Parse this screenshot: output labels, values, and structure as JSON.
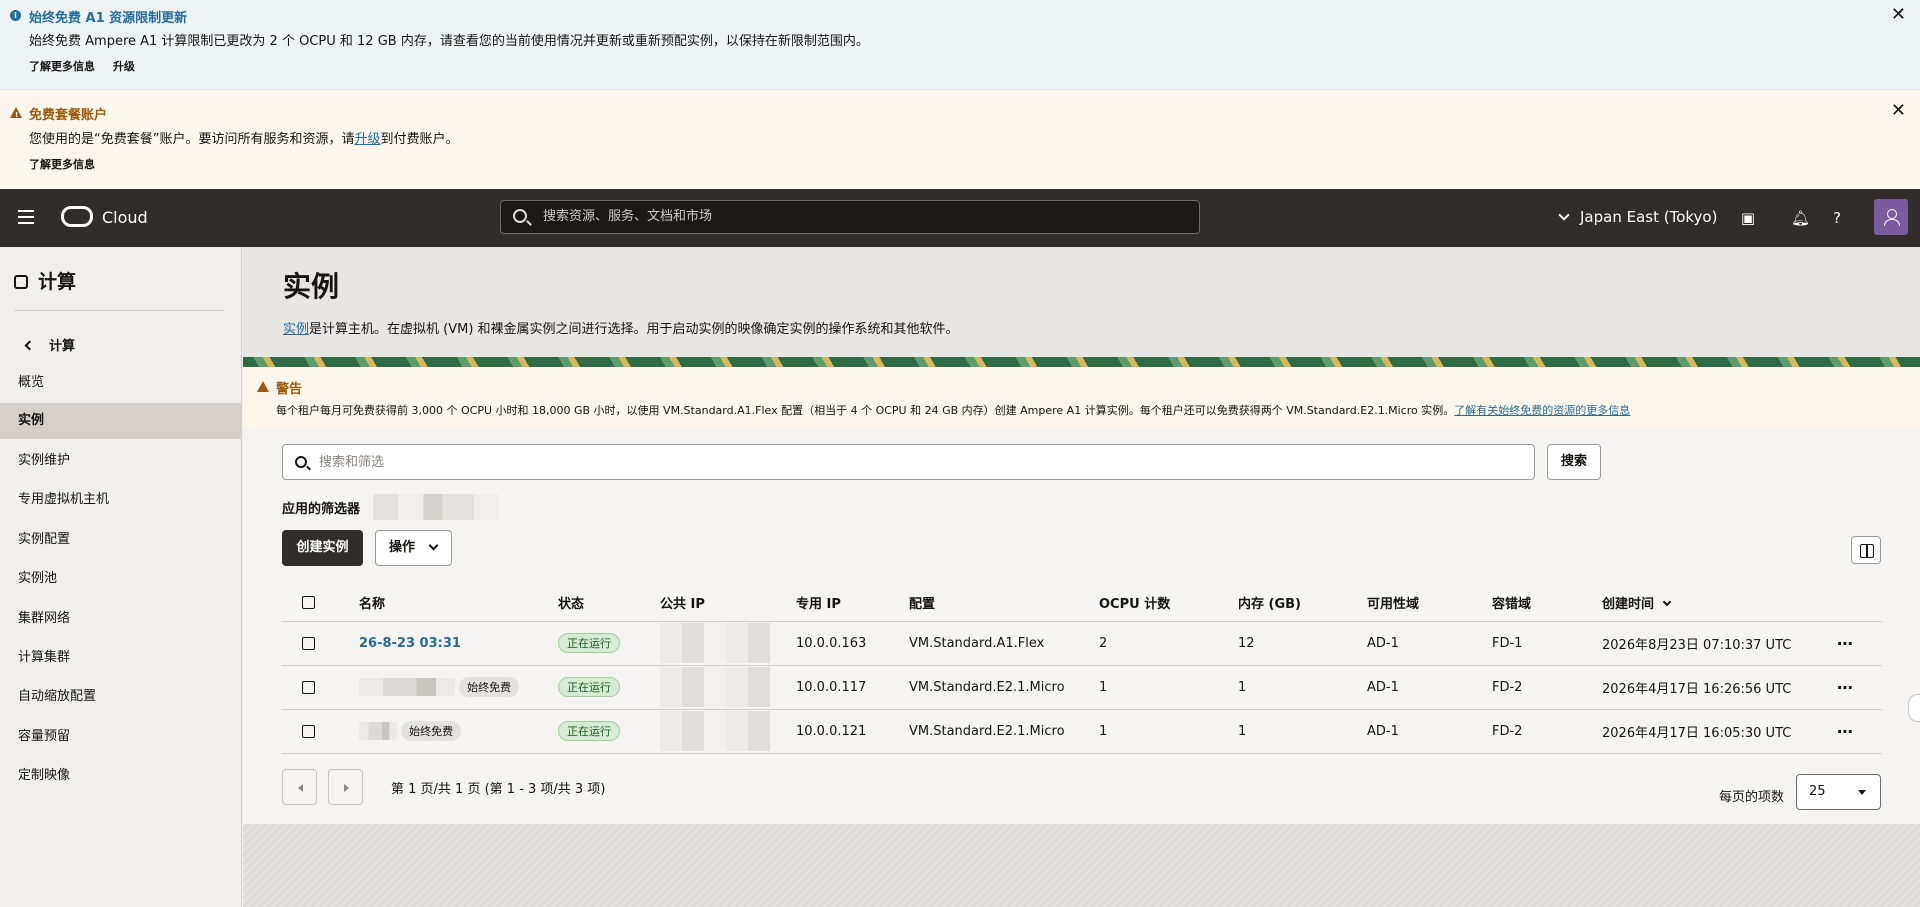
{
  "banners": {
    "info": {
      "title": "始终免费 A1 资源限制更新",
      "text": "始终免费 Ampere A1 计算限制已更改为 2 个 OCPU 和 12 GB 内存，请查看您的当前使用情况并更新或重新预配实例，以保持在新限制范围内。",
      "link_more": "了解更多信息",
      "link_upgrade": "升级"
    },
    "free_tier": {
      "title": "免费套餐账户",
      "text_before": "您使用的是“免费套餐”账户。要访问所有服务和资源，请",
      "text_link": "升级",
      "text_after": "到付费账户。",
      "link_more": "了解更多信息"
    }
  },
  "topnav": {
    "logo": "Cloud",
    "search_placeholder": "搜索资源、服务、文档和市场",
    "region": "Japan East (Tokyo)"
  },
  "sidebar": {
    "title": "计算",
    "back_label": "计算",
    "items": [
      {
        "label": "概览"
      },
      {
        "label": "实例",
        "active": true
      },
      {
        "label": "实例维护"
      },
      {
        "label": "专用虚拟机主机"
      },
      {
        "label": "实例配置"
      },
      {
        "label": "实例池"
      },
      {
        "label": "集群网络"
      },
      {
        "label": "计算集群"
      },
      {
        "label": "自动缩放配置"
      },
      {
        "label": "容量预留"
      },
      {
        "label": "定制映像"
      }
    ]
  },
  "page": {
    "title": "实例",
    "desc_link": "实例",
    "desc_text": "是计算主机。在虚拟机 (VM) 和裸金属实例之间进行选择。用于启动实例的映像确定实例的操作系统和其他软件。"
  },
  "warning": {
    "title": "警告",
    "text": "每个租户每月可免费获得前 3,000 个 OCPU 小时和 18,000 GB 小时，以使用 VM.Standard.A1.Flex 配置（相当于 4 个 OCPU 和 24 GB 内存）创建 Ampere A1 计算实例。每个租户还可以免费获得两个 VM.Standard.E2.1.Micro 实例。",
    "link": "了解有关始终免费的资源的更多信息"
  },
  "toolbar": {
    "filter_placeholder": "搜索和筛选",
    "search_label": "搜索",
    "applied_filters_label": "应用的筛选器",
    "create_label": "创建实例",
    "actions_label": "操作"
  },
  "table": {
    "columns": [
      "名称",
      "状态",
      "公共 IP",
      "专用 IP",
      "配置",
      "OCPU 计数",
      "内存 (GB)",
      "可用性域",
      "容错域",
      "创建时间"
    ],
    "rows": [
      {
        "name": "26-8-23 03:31",
        "badge": "",
        "status": "正在运行",
        "private_ip": "10.0.0.163",
        "shape": "VM.Standard.A1.Flex",
        "ocpu": "2",
        "memory": "12",
        "ad": "AD-1",
        "fd": "FD-1",
        "created": "2026年8月23日 07:10:37 UTC"
      },
      {
        "name": "",
        "badge": "始终免费",
        "status": "正在运行",
        "private_ip": "10.0.0.117",
        "shape": "VM.Standard.E2.1.Micro",
        "ocpu": "1",
        "memory": "1",
        "ad": "AD-1",
        "fd": "FD-2",
        "created": "2026年4月17日 16:26:56 UTC"
      },
      {
        "name": "",
        "badge": "始终免费",
        "status": "正在运行",
        "private_ip": "10.0.0.121",
        "shape": "VM.Standard.E2.1.Micro",
        "ocpu": "1",
        "memory": "1",
        "ad": "AD-1",
        "fd": "FD-2",
        "created": "2026年4月17日 16:05:30 UTC"
      }
    ]
  },
  "pagination": {
    "summary": "第 1 页/共 1 页 (第 1 - 3 项/共 3 项)",
    "per_page_label": "每页的项数",
    "per_page_value": "25"
  },
  "colors": {
    "topnav_bg": "#312d2a",
    "link": "#256d9b",
    "warning": "#9b5b0c",
    "running_bg": "#d7ead3"
  }
}
